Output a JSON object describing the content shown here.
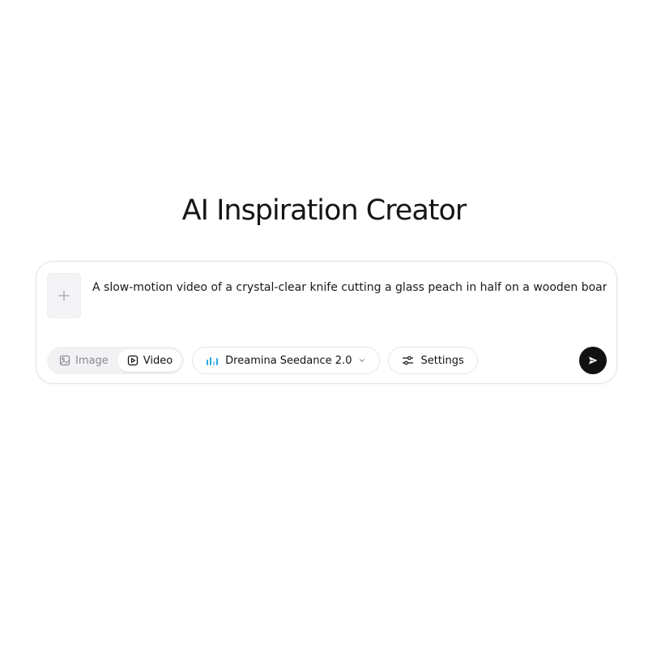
{
  "page": {
    "title": "AI Inspiration Creator"
  },
  "composer": {
    "prompt_text": "A slow-motion video of a crystal-clear knife cutting a glass peach in half on a wooden board.",
    "add_icon": "plus-icon"
  },
  "mode_switch": {
    "options": [
      {
        "label": "Image",
        "icon": "image-icon",
        "active": false
      },
      {
        "label": "Video",
        "icon": "video-icon",
        "active": true
      }
    ]
  },
  "model_selector": {
    "label": "Dreamina Seedance 2.0",
    "icon": "model-bars-icon",
    "dropdown_icon": "chevron-down-icon",
    "accent_color": "#2aa6e8"
  },
  "settings": {
    "label": "Settings",
    "icon": "sliders-icon"
  },
  "send": {
    "icon": "send-icon",
    "color": "#111111"
  }
}
